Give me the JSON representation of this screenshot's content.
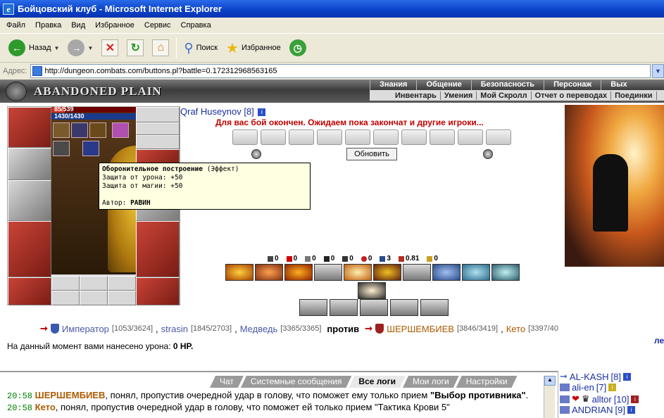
{
  "window": {
    "title": "Бойцовский клуб - Microsoft Internet Explorer"
  },
  "menu": [
    "Файл",
    "Правка",
    "Вид",
    "Избранное",
    "Сервис",
    "Справка"
  ],
  "toolbar": {
    "back_label": "Назад",
    "search_label": "Поиск",
    "favorites_label": "Избранное"
  },
  "address": {
    "label": "Адрес:",
    "url": "http://dungeon.combats.com/buttons.pl?battle=0.172312968563165"
  },
  "site": {
    "logo_text": "ABANDONED PLAIN",
    "nav_top": [
      "Знания",
      "Общение",
      "Безопасность",
      "Персонаж",
      "Вых"
    ],
    "nav_bottom": [
      "Инвентарь",
      "Умения",
      "Мой Скролл",
      "Отчет о переводах",
      "Поединки"
    ]
  },
  "character": {
    "hp_text": "85/539",
    "hp_fraction": 0.158,
    "mp_text": "1430/1430",
    "mp_fraction": 1.0
  },
  "battle": {
    "player_name": "Qraf Huseynov",
    "player_level": "[8]",
    "message": "Для вас бой окончен. Ожидаем пока закончат и другие игроки...",
    "refresh_label": "Обновить",
    "stats": [
      "0",
      "0",
      "0",
      "0",
      "0",
      "0",
      "3",
      "0.81",
      "0"
    ],
    "damage_text": "На данный момент вами нанесено урона:",
    "damage_value": "0 HP."
  },
  "tooltip": {
    "title": "Оборонительное построение",
    "kind": "(Эффект)",
    "line1": "Защита от урона: +50",
    "line2": "Защита от магии: +50",
    "author_label": "Автор:",
    "author": "РАВИН"
  },
  "teams": {
    "ally": [
      {
        "name": "Император",
        "hp": "[1053/3624]"
      },
      {
        "name": "strasin",
        "hp": "[1845/2703]"
      },
      {
        "name": "Медведь",
        "hp": "[3365/3365]"
      }
    ],
    "vs": "против",
    "enemy": [
      {
        "name": "ШЕРШЕМБИЕВ",
        "hp": "[3846/3419]"
      },
      {
        "name": "Кето",
        "hp": "[3397/40"
      }
    ],
    "link_partial": "ле"
  },
  "chat": {
    "tabs": [
      "Чат",
      "Системные сообщения",
      "Все логи",
      "Мои логи",
      "Настройки"
    ],
    "active_tab": "Все логи",
    "line1_time": "20:58",
    "line1_nick": "ШЕРШЕМБИЕВ",
    "line1_text": ", понял, пропустив очередной удар в голову, что поможет ему только прием ",
    "line1_quote": "\"Выбор противника\"",
    "line1_end": ".",
    "line2_time": "20:58",
    "line2_nick": "Кето",
    "line2_text": ", понял, пропустив очередной удар в голову, что поможет ей только прием \"Тактика Крови 5\""
  },
  "users": [
    {
      "name": "AL-KASH",
      "level": "[8]"
    },
    {
      "name": "ali-en",
      "level": "[7]"
    },
    {
      "name": "alltor",
      "level": "[10]"
    },
    {
      "name": "ANDRIAN",
      "level": "[9]"
    }
  ],
  "colors": {
    "title_bar": "#0a3fc7",
    "battle_message": "#c00000",
    "ally": "#4a5aa8",
    "enemy": "#b05a00",
    "chat_time": "#008000"
  }
}
